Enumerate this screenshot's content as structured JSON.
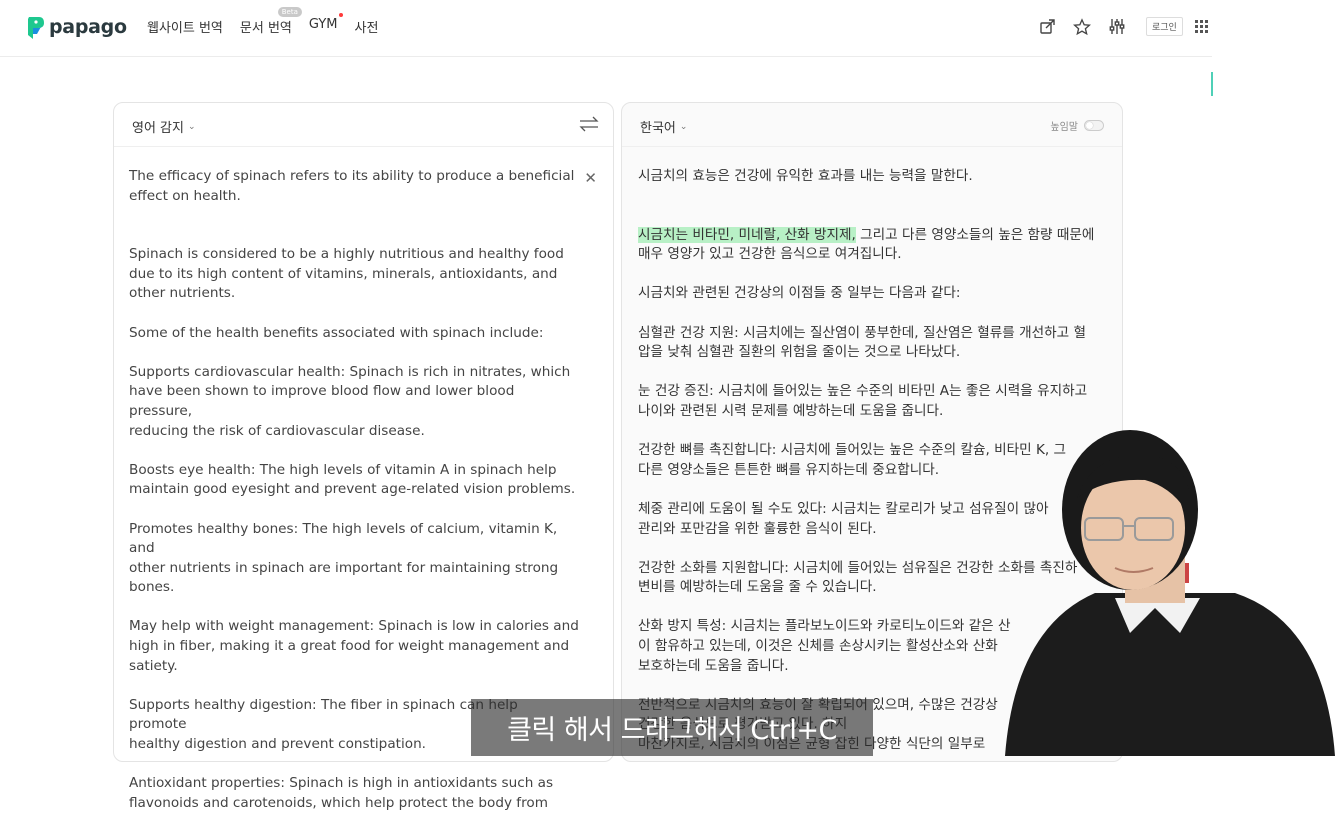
{
  "app": {
    "name": "papago"
  },
  "nav": {
    "items": [
      {
        "label": "웹사이트 번역"
      },
      {
        "label": "문서 번역",
        "badge": "Beta"
      },
      {
        "label": "GYM"
      },
      {
        "label": "사전"
      }
    ]
  },
  "top_icons": [
    "share-icon",
    "star-icon",
    "settings-sliders-icon",
    "apps-grid-icon"
  ],
  "login_label": "로그인",
  "source": {
    "language": "영어 감지",
    "paragraphs": [
      "The efficacy of spinach refers to its ability to produce a beneficial\neffect on health.",
      "Spinach is considered to be a highly nutritious and healthy food\ndue to its high content of vitamins, minerals, antioxidants, and\nother nutrients.",
      "Some of the health benefits associated with spinach include:",
      "Supports cardiovascular health: Spinach is rich in nitrates, which\nhave been shown to improve blood flow and lower blood pressure,\nreducing the risk of cardiovascular disease.",
      "Boosts eye health: The high levels of vitamin A in spinach help\nmaintain good eyesight and prevent age-related vision problems.",
      "Promotes healthy bones: The high levels of calcium, vitamin K, and\nother nutrients in spinach are important for maintaining strong\nbones.",
      "May help with weight management: Spinach is low in calories and\nhigh in fiber, making it a great food for weight management and\nsatiety.",
      "Supports healthy digestion: The fiber in spinach can help promote\nhealthy digestion and prevent constipation.",
      "Antioxidant properties: Spinach is high in antioxidants such as\nflavonoids and carotenoids, which help protect the body from"
    ]
  },
  "target": {
    "language": "한국어",
    "honorific_label": "높임말",
    "honorific_on": false,
    "p1": "시금치의 효능은 건강에 유익한 효과를 내는 능력을 말한다.",
    "p2_highlight": "시금치는 비타민, 미네랄, 산화 방지제,",
    "p2_rest": " 그리고 다른 영양소들의 높은 함량 때문에\n매우 영양가 있고 건강한 음식으로 여겨집니다.",
    "paragraphs": [
      "시금치와 관련된 건강상의 이점들 중 일부는 다음과 같다:",
      "심혈관 건강 지원: 시금치에는 질산염이 풍부한데, 질산염은 혈류를 개선하고 혈\n압을 낮춰 심혈관 질환의 위험을 줄이는 것으로 나타났다.",
      "눈 건강 증진: 시금치에 들어있는 높은 수준의 비타민 A는 좋은 시력을 유지하고\n나이와 관련된 시력 문제를 예방하는데 도움을 줍니다.",
      "건강한 뼈를 촉진합니다: 시금치에 들어있는 높은 수준의 칼슘, 비타민 K, 그\n다른 영양소들은 튼튼한 뼈를 유지하는데 중요합니다.",
      "체중 관리에 도움이 될 수도 있다: 시금치는 칼로리가 낮고 섬유질이 많아\n관리와 포만감을 위한 훌륭한 음식이 된다.",
      "건강한 소화를 지원합니다: 시금치에 들어있는 섬유질은 건강한 소화를 촉진하\n변비를 예방하는데 도움을 줄 수 있습니다.",
      "산화 방지 특성: 시금치는 플라보노이드와 카로티노이드와 같은 산\n이 함유하고 있는데, 이것은 신체를 손상시키는 활성산소와 산화\n보호하는데 도움을 줍니다.",
      "전반적으로 시금치의 효능이 잘 확립되어 있으며, 수많은 건강상\n                 건강한 음식으로 평가받고 있다. 하지\n마찬가지로, 시금치의 이점은 균형 잡힌 다양한 식단의 일부로"
    ]
  },
  "subtitle": "클릭 해서 드래그해서 Ctrl+C"
}
